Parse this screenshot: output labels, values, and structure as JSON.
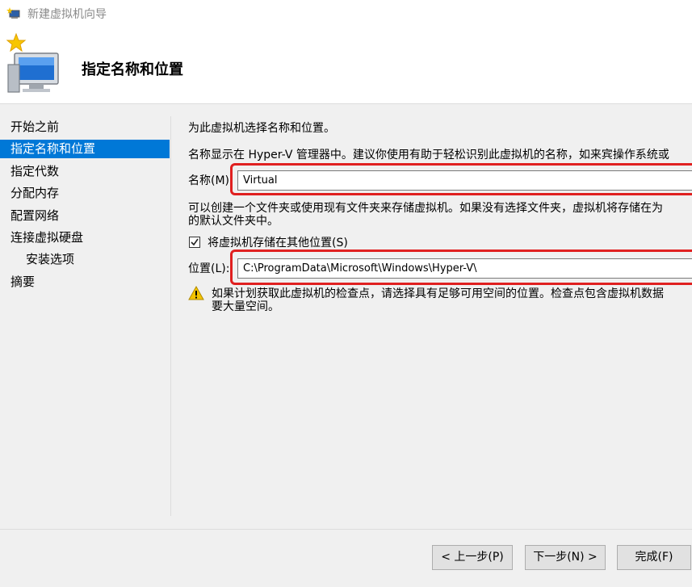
{
  "window": {
    "title": "新建虚拟机向导"
  },
  "header": {
    "title": "指定名称和位置"
  },
  "nav": {
    "items": [
      {
        "label": "开始之前"
      },
      {
        "label": "指定名称和位置"
      },
      {
        "label": "指定代数"
      },
      {
        "label": "分配内存"
      },
      {
        "label": "配置网络"
      },
      {
        "label": "连接虚拟硬盘"
      },
      {
        "label": "安装选项"
      },
      {
        "label": "摘要"
      }
    ]
  },
  "main": {
    "intro": "为此虚拟机选择名称和位置。",
    "name_desc": "名称显示在 Hyper-V 管理器中。建议你使用有助于轻松识别此虚拟机的名称，如来宾操作系统或",
    "name_label": "名称(M):",
    "name_value": "Virtual",
    "folder_desc_1": "可以创建一个文件夹或使用现有文件夹来存储虚拟机。如果没有选择文件夹，虚拟机将存储在为",
    "folder_desc_2": "的默认文件夹中。",
    "store_checkbox_label": "将虚拟机存储在其他位置(S)",
    "store_checked": true,
    "location_label": "位置(L):",
    "location_value": "C:\\ProgramData\\Microsoft\\Windows\\Hyper-V\\",
    "warning_1": "如果计划获取此虚拟机的检查点，请选择具有足够可用空间的位置。检查点包含虚拟机数据",
    "warning_2": "要大量空间。"
  },
  "footer": {
    "prev_label": "< 上一步(P)",
    "next_label": "下一步(N) >",
    "finish_label": "完成(F)"
  },
  "colors": {
    "accent": "#0078d7",
    "highlight_box": "#e02020"
  }
}
